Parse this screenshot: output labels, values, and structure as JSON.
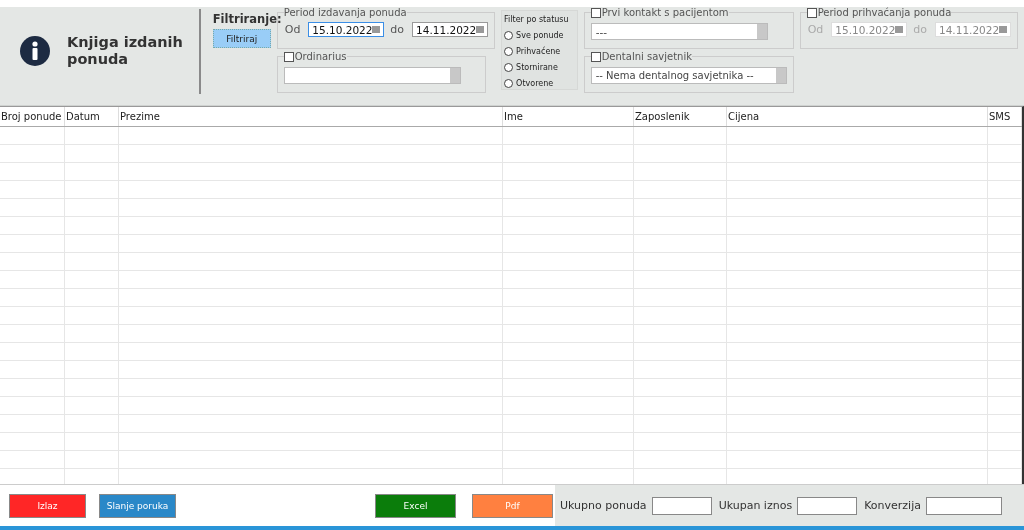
{
  "header": {
    "title": "Knjiga izdanih ponuda"
  },
  "filter": {
    "label": "Filtriranje:",
    "button": "Filtriraj",
    "issue_period": {
      "legend": "Period izdavanja ponuda",
      "from_label": "Od",
      "from": "15.10.2022",
      "to_label": "do",
      "to": "14.11.2022"
    },
    "ordinarius": {
      "label": "Ordinarius",
      "checked": false
    },
    "status": {
      "title": "Filter po statusu",
      "options": [
        {
          "label": "Sve ponude",
          "selected": false
        },
        {
          "label": "Prihvaćene",
          "selected": false
        },
        {
          "label": "Stornirane",
          "selected": false
        },
        {
          "label": "Otvorene",
          "selected": false
        }
      ]
    },
    "first_contact": {
      "label": "Prvi kontakt s pacijentom",
      "checked": false,
      "value": "---"
    },
    "dental_advisor": {
      "label": "Dentalni savjetnik",
      "checked": false,
      "value": "-- Nema dentalnog savjetnika --"
    },
    "accept_period": {
      "label": "Period prihvaćanja ponuda",
      "checked": false,
      "disabled": true,
      "from_label": "Od",
      "from": "15.10.2022",
      "to_label": "do",
      "to": "14.11.2022"
    }
  },
  "table": {
    "columns": [
      "Broj ponude",
      "Datum",
      "Prezime",
      "Ime",
      "Zaposlenik",
      "Cijena",
      "SMS"
    ]
  },
  "footer": {
    "buttons": [
      {
        "label": "Izlaz",
        "kind": "exit"
      },
      {
        "label": "Slanje poruka",
        "kind": "message"
      },
      {
        "label": "Excel",
        "kind": "excel"
      },
      {
        "label": "Pdf",
        "kind": "pdf"
      }
    ],
    "totals": [
      {
        "label": "Ukupno ponuda"
      },
      {
        "label": "Ukupan iznos"
      },
      {
        "label": "Konverzija"
      }
    ]
  }
}
